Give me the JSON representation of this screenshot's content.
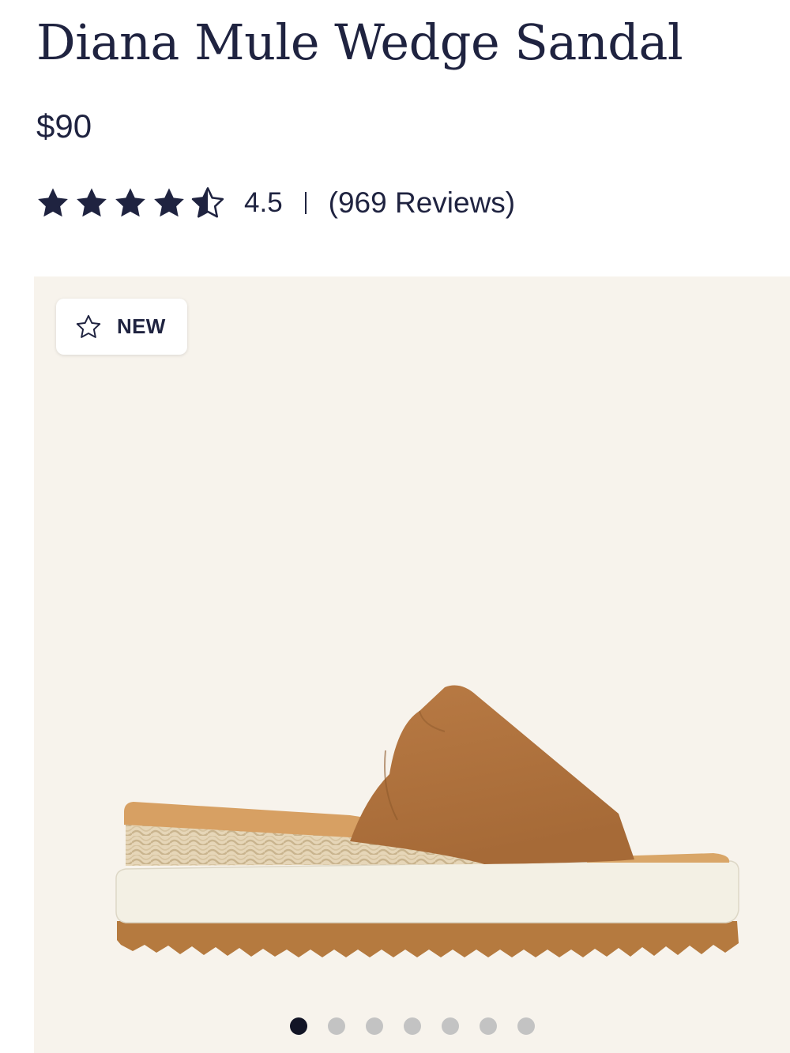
{
  "product": {
    "title": "Diana Mule Wedge Sandal",
    "price": "$90"
  },
  "rating": {
    "value": "4.5",
    "stars_filled": 4.5,
    "stars_total": 5,
    "reviews_label": "(969 Reviews)",
    "star_color": "#1f2340"
  },
  "gallery": {
    "background_color": "#f7f3ec",
    "badge": {
      "icon": "star-outline-icon",
      "label": "NEW"
    },
    "image": {
      "alt": "Diana Mule Wedge Sandal"
    },
    "slide_count": 7,
    "active_slide": 1
  },
  "colors": {
    "text": "#1f2340",
    "dot_active": "#121526",
    "dot_inactive": "#c3c3c3"
  }
}
